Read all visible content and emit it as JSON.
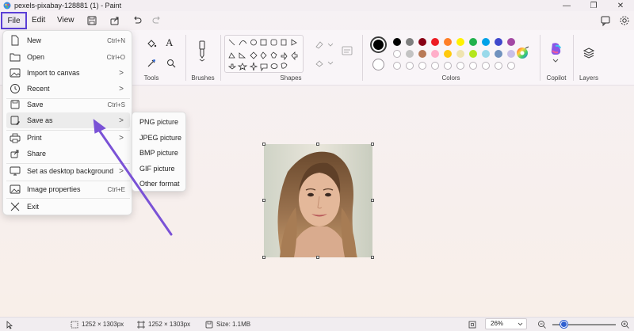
{
  "window": {
    "title": "pexels-pixabay-128881 (1) - Paint",
    "minimize": "—",
    "maximize": "❐",
    "close": "✕"
  },
  "menubar": {
    "file": "File",
    "edit": "Edit",
    "view": "View"
  },
  "ribbon": {
    "tools_label": "Tools",
    "brushes_label": "Brushes",
    "shapes_label": "Shapes",
    "colors_label": "Colors",
    "copilot_label": "Copilot",
    "layers_label": "Layers",
    "text_tool": "A",
    "palette_row1": [
      "#000000",
      "#7f7f7f",
      "#880015",
      "#ed1c24",
      "#ff7f27",
      "#fff200",
      "#22b14c",
      "#00a2e8",
      "#3f48cc",
      "#a349a4"
    ],
    "palette_row2": [
      "#ffffff",
      "#c3c3c3",
      "#b97a57",
      "#ffaec9",
      "#ffc90e",
      "#efe4b0",
      "#b5e61d",
      "#99d9ea",
      "#7092be",
      "#c8bfe7"
    ]
  },
  "file_menu": {
    "items": [
      {
        "label": "New",
        "shortcut": "Ctrl+N"
      },
      {
        "label": "Open",
        "shortcut": "Ctrl+O"
      },
      {
        "label": "Import to canvas",
        "arrow": ">"
      },
      {
        "label": "Recent",
        "arrow": ">"
      },
      {
        "label": "Save",
        "shortcut": "Ctrl+S"
      },
      {
        "label": "Save as",
        "arrow": ">"
      },
      {
        "label": "Print",
        "arrow": ">"
      },
      {
        "label": "Share"
      },
      {
        "label": "Set as desktop background",
        "arrow": ">"
      },
      {
        "label": "Image properties",
        "shortcut": "Ctrl+E"
      },
      {
        "label": "Exit"
      }
    ]
  },
  "save_as_menu": {
    "items": [
      "PNG picture",
      "JPEG picture",
      "BMP picture",
      "GIF picture",
      "Other format"
    ]
  },
  "statusbar": {
    "selection_size": "1252 × 1303px",
    "canvas_size": "1252 × 1303px",
    "file_size": "Size: 1.1MB",
    "zoom": "26%"
  },
  "colors": {
    "accent": "#5b3fd6",
    "arrow": "#7a52d6"
  }
}
